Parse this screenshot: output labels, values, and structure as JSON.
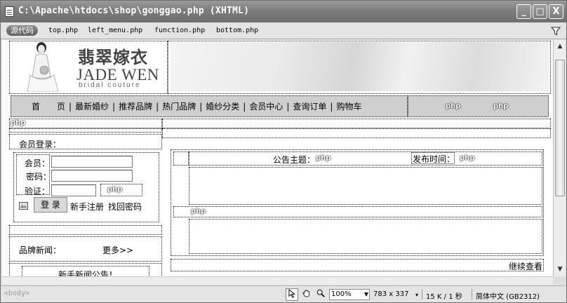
{
  "window": {
    "title": "C:\\Apache\\htdocs\\shop\\gonggao.php (XHTML)",
    "buttons": {
      "minimize": "_",
      "maximize": "□",
      "close": "X"
    }
  },
  "docbar": {
    "source_label": "源代码",
    "related_files": [
      "top.php",
      "left_menu.php",
      "function.php",
      "bottom.php"
    ]
  },
  "header": {
    "logo_cn": "翡翠嫁衣",
    "logo_en": "JADE WEN",
    "logo_sub": "bridal couture"
  },
  "nav": {
    "items": [
      "首　　页",
      "最新婚纱",
      "推荐品牌",
      "热门品牌",
      "婚纱分类",
      "会员中心",
      "查询订单",
      "购物车"
    ],
    "separator": "|"
  },
  "php_tag": "php",
  "login": {
    "title": "会员登录：",
    "member_label": "会员：",
    "password_label": "密码：",
    "verify_label": "验证：",
    "member_value": "",
    "password_value": "",
    "verify_value": "",
    "login_button": "登 录",
    "register_link": "新手注册",
    "recover_link": "找回密码"
  },
  "news": {
    "title": "品牌新闻：",
    "more_link": "更多>>",
    "subheading": "新手新闻公告！"
  },
  "notice": {
    "subject_label": "公告主题：",
    "time_label": "发布时间：",
    "continue_link": "继续查看"
  },
  "statusbar": {
    "tag_selector": "<body>",
    "zoom": "100%",
    "dimensions": "783 x 337",
    "size_time": "15 K / 1 秒",
    "encoding": "简体中文 (GB2312)"
  },
  "icons": {
    "title": "document-icon",
    "filter": "filter-icon",
    "pointer": "pointer-tool-icon",
    "hand": "hand-tool-icon",
    "zoom": "zoom-tool-icon"
  }
}
